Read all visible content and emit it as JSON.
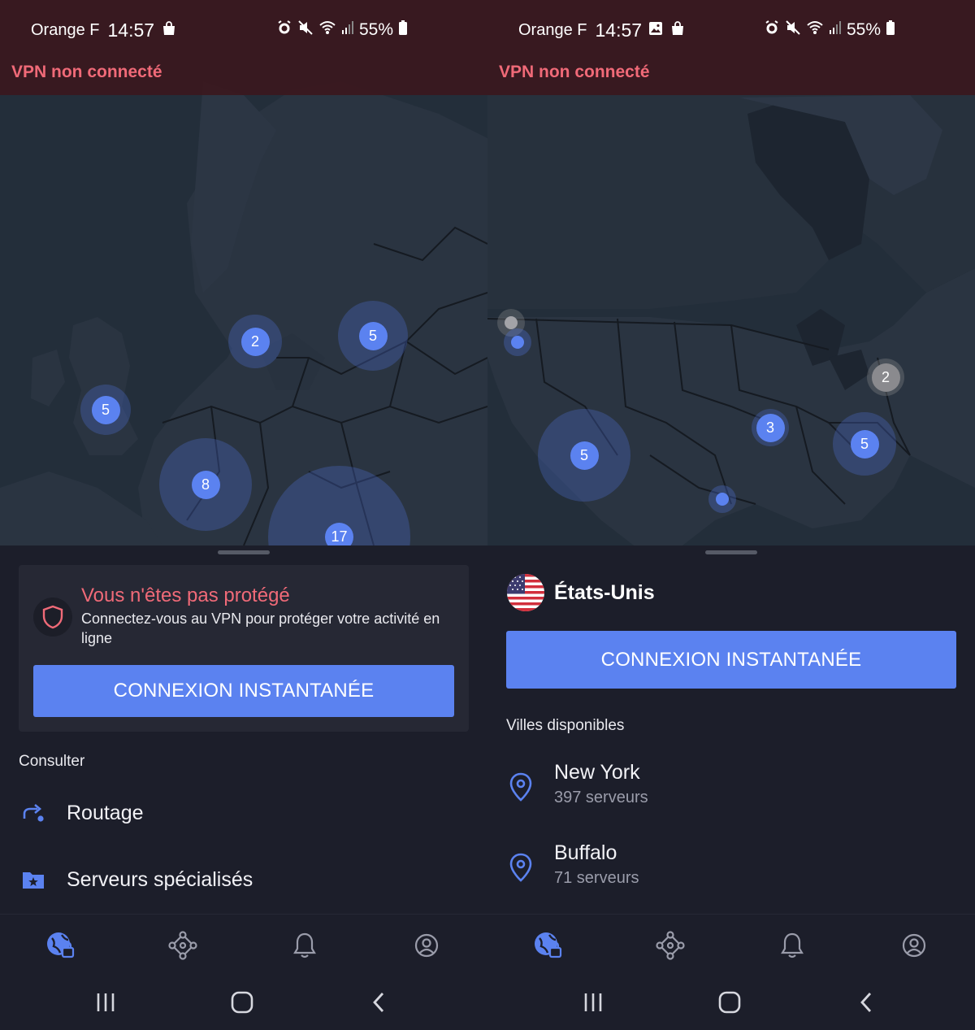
{
  "status_bar": {
    "carrier": "Orange F",
    "time": "14:57",
    "battery": "55%"
  },
  "vpn_status": "VPN non connecté",
  "left": {
    "clusters": [
      {
        "label": "5"
      },
      {
        "label": "2"
      },
      {
        "label": "5"
      },
      {
        "label": "8"
      },
      {
        "label": "17"
      }
    ],
    "card": {
      "title": "Vous n'êtes pas protégé",
      "subtitle": "Connectez-vous au VPN pour protéger votre activité en ligne",
      "button": "CONNEXION INSTANTANÉE"
    },
    "section": "Consulter",
    "menu": [
      {
        "label": "Routage",
        "icon": "route-arrow-icon"
      },
      {
        "label": "Serveurs spécialisés",
        "icon": "star-folder-icon"
      }
    ]
  },
  "right": {
    "clusters": [
      {
        "label": "5"
      },
      {
        "label": "3"
      },
      {
        "label": "5"
      },
      {
        "label": "2"
      }
    ],
    "country": "États-Unis",
    "button": "CONNEXION INSTANTANÉE",
    "section": "Villes disponibles",
    "cities": [
      {
        "name": "New York",
        "servers": "397 serveurs"
      },
      {
        "name": "Buffalo",
        "servers": "71 serveurs"
      }
    ]
  },
  "nav": {
    "items": [
      "globe-lock-icon",
      "mesh-network-icon",
      "bell-icon",
      "profile-icon"
    ],
    "active": "globe-lock-icon"
  },
  "colors": {
    "accent": "#5b82f0",
    "warning": "#f06a78",
    "background": "#1c1e2a"
  }
}
